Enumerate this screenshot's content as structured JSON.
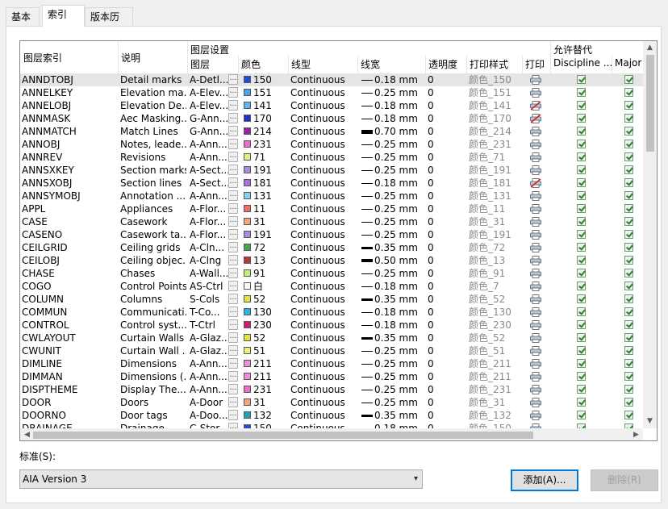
{
  "tabs": [
    {
      "label": "基本"
    },
    {
      "label": "索引"
    },
    {
      "label": "版本历史"
    }
  ],
  "active_tab": 1,
  "columns": {
    "index": "图层索引",
    "desc": "说明",
    "group_settings": "图层设置",
    "layer": "图层",
    "color": "颜色",
    "linetype": "线型",
    "lineweight": "线宽",
    "transparency": "透明度",
    "plotstyle": "打印样式",
    "plot": "打印",
    "group_override": "允许替代",
    "discipline": "Discipline ...",
    "major": "Major"
  },
  "rows": [
    {
      "idx": "ANNDTOBJ",
      "desc": "Detail marks",
      "layer": "A-Detl...",
      "color": "#1f4fd8",
      "cnum": "150",
      "lt": "Continuous",
      "lw": "0.18 mm",
      "tr": "0",
      "ps": "颜色_150",
      "plot": "printer-icon",
      "sel": true
    },
    {
      "idx": "ANNELKEY",
      "desc": "Elevation ma...",
      "layer": "A-Elev...",
      "color": "#4aa3e8",
      "cnum": "151",
      "lt": "Continuous",
      "lw": "0.25 mm",
      "tr": "0",
      "ps": "颜色_151",
      "plot": "printer-icon"
    },
    {
      "idx": "ANNELOBJ",
      "desc": "Elevation De...",
      "layer": "A-Elev...",
      "color": "#5fb5f0",
      "cnum": "141",
      "lt": "Continuous",
      "lw": "0.18 mm",
      "tr": "0",
      "ps": "颜色_141",
      "plot": "no-plot-icon"
    },
    {
      "idx": "ANNMASK",
      "desc": "Aec Masking...",
      "layer": "G-Ann...",
      "color": "#2233cc",
      "cnum": "170",
      "lt": "Continuous",
      "lw": "0.18 mm",
      "tr": "0",
      "ps": "颜色_170",
      "plot": "no-plot-icon"
    },
    {
      "idx": "ANNMATCH",
      "desc": "Match Lines",
      "layer": "G-Ann...",
      "color": "#9b1fa8",
      "cnum": "214",
      "lt": "Continuous",
      "lw": "0.70 mm",
      "tr": "0",
      "ps": "颜色_214",
      "plot": "printer-icon"
    },
    {
      "idx": "ANNOBJ",
      "desc": "Notes, leade...",
      "layer": "A-Ann...",
      "color": "#f06bd0",
      "cnum": "231",
      "lt": "Continuous",
      "lw": "0.25 mm",
      "tr": "0",
      "ps": "颜色_231",
      "plot": "printer-icon"
    },
    {
      "idx": "ANNREV",
      "desc": "Revisions",
      "layer": "A-Ann...",
      "color": "#d6f08a",
      "cnum": "71",
      "lt": "Continuous",
      "lw": "0.25 mm",
      "tr": "0",
      "ps": "颜色_71",
      "plot": "printer-icon"
    },
    {
      "idx": "ANNSXKEY",
      "desc": "Section marks",
      "layer": "A-Sect...",
      "color": "#a98be6",
      "cnum": "191",
      "lt": "Continuous",
      "lw": "0.25 mm",
      "tr": "0",
      "ps": "颜色_191",
      "plot": "printer-icon"
    },
    {
      "idx": "ANNSXOBJ",
      "desc": "Section lines",
      "layer": "A-Sect...",
      "color": "#a96de0",
      "cnum": "181",
      "lt": "Continuous",
      "lw": "0.18 mm",
      "tr": "0",
      "ps": "颜色_181",
      "plot": "no-plot-icon"
    },
    {
      "idx": "ANNSYMOBJ",
      "desc": "Annotation ...",
      "layer": "A-Ann...",
      "color": "#84d3f5",
      "cnum": "131",
      "lt": "Continuous",
      "lw": "0.25 mm",
      "tr": "0",
      "ps": "颜色_131",
      "plot": "printer-icon"
    },
    {
      "idx": "APPL",
      "desc": "Appliances",
      "layer": "A-Flor...",
      "color": "#f26b5f",
      "cnum": "11",
      "lt": "Continuous",
      "lw": "0.25 mm",
      "tr": "0",
      "ps": "颜色_11",
      "plot": "printer-icon"
    },
    {
      "idx": "CASE",
      "desc": "Casework",
      "layer": "A-Flor...",
      "color": "#f2a77a",
      "cnum": "31",
      "lt": "Continuous",
      "lw": "0.25 mm",
      "tr": "0",
      "ps": "颜色_31",
      "plot": "printer-icon"
    },
    {
      "idx": "CASENO",
      "desc": "Casework ta...",
      "layer": "A-Flor...",
      "color": "#a98be6",
      "cnum": "191",
      "lt": "Continuous",
      "lw": "0.25 mm",
      "tr": "0",
      "ps": "颜色_191",
      "plot": "printer-icon"
    },
    {
      "idx": "CEILGRID",
      "desc": "Ceiling grids",
      "layer": "A-Cln...",
      "color": "#44a84a",
      "cnum": "72",
      "lt": "Continuous",
      "lw": "0.35 mm",
      "tr": "0",
      "ps": "颜色_72",
      "plot": "printer-icon"
    },
    {
      "idx": "CEILOBJ",
      "desc": "Ceiling objec...",
      "layer": "A-Clng",
      "color": "#b03a3a",
      "cnum": "13",
      "lt": "Continuous",
      "lw": "0.50 mm",
      "tr": "0",
      "ps": "颜色_13",
      "plot": "printer-icon"
    },
    {
      "idx": "CHASE",
      "desc": "Chases",
      "layer": "A-Wall...",
      "color": "#c9ec7a",
      "cnum": "91",
      "lt": "Continuous",
      "lw": "0.25 mm",
      "tr": "0",
      "ps": "颜色_91",
      "plot": "printer-icon"
    },
    {
      "idx": "COGO",
      "desc": "Control Points",
      "layer": "AS-Ctrl",
      "color": "#ffffff",
      "cnum": "白",
      "lt": "Continuous",
      "lw": "0.18 mm",
      "tr": "0",
      "ps": "颜色_7",
      "plot": "printer-icon"
    },
    {
      "idx": "COLUMN",
      "desc": "Columns",
      "layer": "S-Cols",
      "color": "#e8e23a",
      "cnum": "52",
      "lt": "Continuous",
      "lw": "0.35 mm",
      "tr": "0",
      "ps": "颜色_52",
      "plot": "printer-icon"
    },
    {
      "idx": "COMMUN",
      "desc": "Communicati...",
      "layer": "T-Co...",
      "color": "#22b8e6",
      "cnum": "130",
      "lt": "Continuous",
      "lw": "0.18 mm",
      "tr": "0",
      "ps": "颜色_130",
      "plot": "printer-icon"
    },
    {
      "idx": "CONTROL",
      "desc": "Control syst...",
      "layer": "T-Ctrl",
      "color": "#d81a6f",
      "cnum": "230",
      "lt": "Continuous",
      "lw": "0.18 mm",
      "tr": "0",
      "ps": "颜色_230",
      "plot": "printer-icon"
    },
    {
      "idx": "CWLAYOUT",
      "desc": "Curtain Walls",
      "layer": "A-Glaz...",
      "color": "#e8e23a",
      "cnum": "52",
      "lt": "Continuous",
      "lw": "0.35 mm",
      "tr": "0",
      "ps": "颜色_52",
      "plot": "printer-icon"
    },
    {
      "idx": "CWUNIT",
      "desc": "Curtain Wall ...",
      "layer": "A-Glaz...",
      "color": "#f3ee7c",
      "cnum": "51",
      "lt": "Continuous",
      "lw": "0.25 mm",
      "tr": "0",
      "ps": "颜色_51",
      "plot": "printer-icon"
    },
    {
      "idx": "DIMLINE",
      "desc": "Dimensions",
      "layer": "A-Ann...",
      "color": "#f08be0",
      "cnum": "211",
      "lt": "Continuous",
      "lw": "0.25 mm",
      "tr": "0",
      "ps": "颜色_211",
      "plot": "printer-icon"
    },
    {
      "idx": "DIMMAN",
      "desc": "Dimensions (...",
      "layer": "A-Ann...",
      "color": "#f08be0",
      "cnum": "211",
      "lt": "Continuous",
      "lw": "0.25 mm",
      "tr": "0",
      "ps": "颜色_211",
      "plot": "printer-icon"
    },
    {
      "idx": "DISPTHEME",
      "desc": "Display The...",
      "layer": "A-Ann...",
      "color": "#f06bd0",
      "cnum": "231",
      "lt": "Continuous",
      "lw": "0.25 mm",
      "tr": "0",
      "ps": "颜色_231",
      "plot": "printer-icon"
    },
    {
      "idx": "DOOR",
      "desc": "Doors",
      "layer": "A-Door",
      "color": "#f2a77a",
      "cnum": "31",
      "lt": "Continuous",
      "lw": "0.25 mm",
      "tr": "0",
      "ps": "颜色_31",
      "plot": "printer-icon"
    },
    {
      "idx": "DOORNO",
      "desc": "Door tags",
      "layer": "A-Doo...",
      "color": "#1aa6b8",
      "cnum": "132",
      "lt": "Continuous",
      "lw": "0.35 mm",
      "tr": "0",
      "ps": "颜色_132",
      "plot": "printer-icon"
    },
    {
      "idx": "DRAINAGE",
      "desc": "Drainage",
      "layer": "C-Stor...",
      "color": "#1f4fd8",
      "cnum": "150",
      "lt": "Continuous",
      "lw": "0.18 mm",
      "tr": "0",
      "ps": "颜色_150",
      "plot": "printer-icon"
    }
  ],
  "standard": {
    "label": "标准(S):",
    "value": "AIA Version 3"
  },
  "buttons": {
    "add": "添加(A)...",
    "delete": "删除(R)"
  }
}
